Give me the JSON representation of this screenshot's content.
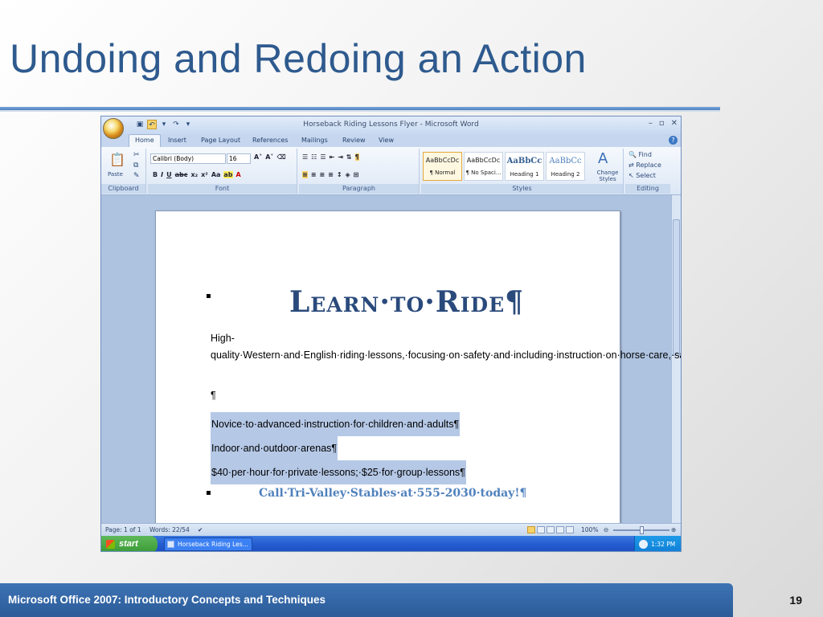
{
  "slide": {
    "title": "Undoing and Redoing an Action",
    "footer": "Microsoft Office 2007: Introductory Concepts and Techniques",
    "page_number": "19"
  },
  "window": {
    "title": "Horseback Riding Lessons Flyer - Microsoft Word",
    "controls": [
      "–",
      "▫",
      "✕"
    ]
  },
  "tabs": [
    "Home",
    "Insert",
    "Page Layout",
    "References",
    "Mailings",
    "Review",
    "View"
  ],
  "ribbon": {
    "clipboard": {
      "label": "Clipboard",
      "paste": "Paste"
    },
    "font": {
      "label": "Font",
      "name": "Calibri (Body)",
      "size": "16"
    },
    "paragraph": {
      "label": "Paragraph"
    },
    "styles": {
      "label": "Styles",
      "items": [
        {
          "sample": "AaBbCcDc",
          "name": "¶ Normal"
        },
        {
          "sample": "AaBbCcDc",
          "name": "¶ No Spaci..."
        },
        {
          "sample": "AaBbCc",
          "name": "Heading 1"
        },
        {
          "sample": "AaBbCc",
          "name": "Heading 2"
        }
      ],
      "change": "Change Styles"
    },
    "editing": {
      "label": "Editing",
      "find": "Find",
      "replace": "Replace",
      "select": "Select"
    }
  },
  "document": {
    "heading": "Learn·to·Ride¶",
    "body": "High-quality·Western·and·English·riding·lessons,·focusing·on·safety·and·including·instruction·on·horse·care,·saddling·a·horse,·and·other·aspects·of·horsemanship.¶",
    "blank": "¶",
    "list": [
      "Novice·to·advanced·instruction·for·children·and·adults¶",
      "Indoor·and·outdoor·arenas¶",
      "$40·per·hour·for·private·lessons;·$25·for·group·lessons¶"
    ],
    "call": "Call·Tri-Valley·Stables·at·555-2030·today!¶"
  },
  "statusbar": {
    "page": "Page: 1 of 1",
    "words": "Words: 22/54",
    "zoom": "100%"
  },
  "taskbar": {
    "start": "start",
    "task": "Horseback Riding Les...",
    "clock": "1:32 PM"
  }
}
